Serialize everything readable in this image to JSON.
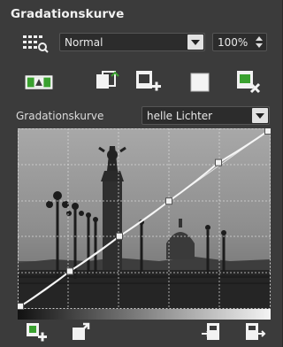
{
  "panel": {
    "title": "Gradationskurve"
  },
  "mode_select": {
    "value": "Normal"
  },
  "zoom": {
    "value": "100%"
  },
  "curve_label": "Gradationskurve",
  "preset_select": {
    "value": "helle Lichter"
  },
  "icons": {
    "grid": "grid-settings-icon",
    "toolbar": [
      "auto-curve-icon",
      "copy-curve-icon",
      "add-point-icon",
      "white-square-icon",
      "delete-curve-icon"
    ],
    "bottom": [
      "add-preset-icon",
      "export-preset-icon",
      "import-icon",
      "save-icon"
    ]
  },
  "curve": {
    "points": [
      [
        0,
        0
      ],
      [
        0.2,
        0.2
      ],
      [
        0.4,
        0.4
      ],
      [
        0.6,
        0.6
      ],
      [
        0.8,
        0.82
      ],
      [
        1,
        1
      ]
    ],
    "baseline": [
      [
        0,
        0
      ],
      [
        1,
        1
      ]
    ]
  }
}
